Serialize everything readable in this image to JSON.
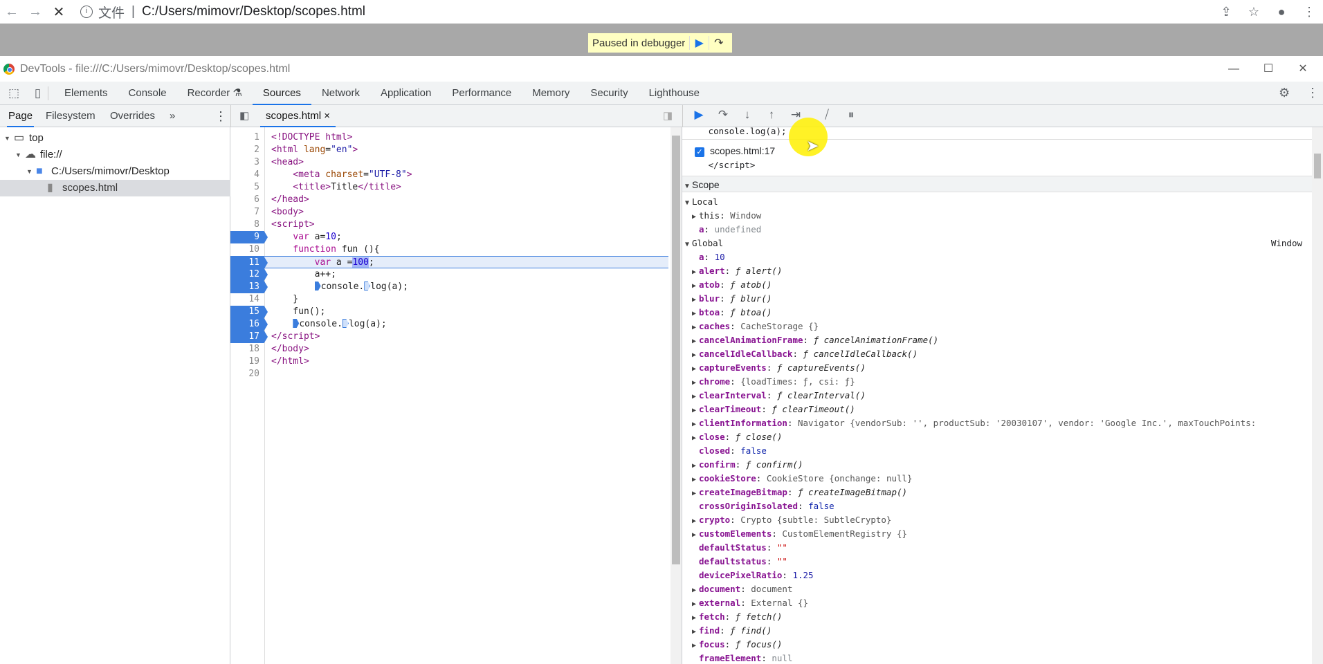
{
  "browser": {
    "back_icon": "arrow-left",
    "forward_icon": "arrow-right",
    "stop_icon": "close",
    "info_label": "文件",
    "url": "C:/Users/mimovr/Desktop/scopes.html"
  },
  "banner": {
    "text": "Paused in debugger"
  },
  "devtools": {
    "title": "DevTools - file:///C:/Users/mimovr/Desktop/scopes.html",
    "tabs": [
      "Elements",
      "Console",
      "Recorder",
      "Sources",
      "Network",
      "Application",
      "Performance",
      "Memory",
      "Security",
      "Lighthouse"
    ],
    "active_tab": "Sources"
  },
  "navigator": {
    "tabs": [
      "Page",
      "Filesystem",
      "Overrides"
    ],
    "more": "»",
    "tree": [
      {
        "label": "top",
        "depth": 0,
        "icon": "frame"
      },
      {
        "label": "file://",
        "depth": 1,
        "icon": "cloud"
      },
      {
        "label": "C:/Users/mimovr/Desktop",
        "depth": 2,
        "icon": "folder"
      },
      {
        "label": "scopes.html",
        "depth": 3,
        "icon": "file",
        "selected": true
      }
    ]
  },
  "editor": {
    "file_tab": "scopes.html",
    "close": "×",
    "current_line": 11,
    "breakpoints": [
      9,
      11,
      12,
      13,
      15,
      16,
      17
    ],
    "lines": [
      [
        [
          "<!DOCTYPE html>",
          "tag"
        ]
      ],
      [
        [
          "<html ",
          "tag"
        ],
        [
          "lang",
          "attr"
        ],
        [
          "=",
          "p"
        ],
        [
          "\"en\"",
          "str"
        ],
        [
          ">",
          "tag"
        ]
      ],
      [
        [
          "<head>",
          "tag"
        ]
      ],
      [
        [
          "    <meta ",
          "tag"
        ],
        [
          "charset",
          "attr"
        ],
        [
          "=",
          "p"
        ],
        [
          "\"UTF-8\"",
          "str"
        ],
        [
          ">",
          "tag"
        ]
      ],
      [
        [
          "    <title>",
          "tag"
        ],
        [
          "Title",
          "p"
        ],
        [
          "</title>",
          "tag"
        ]
      ],
      [
        [
          "</head>",
          "tag"
        ]
      ],
      [
        [
          "<body>",
          "tag"
        ]
      ],
      [
        [
          "<script>",
          "tag"
        ]
      ],
      [
        [
          "    ",
          "p"
        ],
        [
          "var",
          "kw"
        ],
        [
          " a=",
          "p"
        ],
        [
          "10",
          "num"
        ],
        [
          ";",
          "p"
        ]
      ],
      [
        [
          "    ",
          "p"
        ],
        [
          "function",
          "kw"
        ],
        [
          " fun (){",
          "p"
        ]
      ],
      [
        [
          "        ",
          "p"
        ],
        [
          "var",
          "kw"
        ],
        [
          " a =",
          "p"
        ],
        [
          "100",
          "sel"
        ],
        [
          ";",
          "p"
        ]
      ],
      [
        [
          "        a++;",
          "p"
        ]
      ],
      [
        [
          "        ",
          "p"
        ],
        [
          "",
          "bp"
        ],
        [
          "console.",
          "p"
        ],
        [
          "",
          "bpoff"
        ],
        [
          "log(a);",
          "p"
        ]
      ],
      [
        [
          "    }",
          "p"
        ]
      ],
      [
        [
          "    fun();",
          "p"
        ]
      ],
      [
        [
          "    ",
          "p"
        ],
        [
          "",
          "bp"
        ],
        [
          "console.",
          "p"
        ],
        [
          "",
          "bpoff"
        ],
        [
          "log(a);",
          "p"
        ]
      ],
      [
        [
          "</script>",
          "tag"
        ]
      ],
      [
        [
          "</body>",
          "tag"
        ]
      ],
      [
        [
          "</html>",
          "tag"
        ]
      ],
      []
    ]
  },
  "debugger": {
    "toolbar": [
      "resume",
      "step-over",
      "step-into",
      "step-out",
      "step",
      "deactivate-breakpoints",
      "pause-on-exceptions"
    ],
    "breakpoint_prev_code": "console.log(a);",
    "breakpoint": {
      "label": "scopes.html:17",
      "code": "</script>",
      "checked": true
    },
    "scope_title": "Scope",
    "local": {
      "title": "Local",
      "items": [
        {
          "k": "this",
          "v": "Window",
          "t": "obj",
          "exp": true,
          "kc": "plain"
        },
        {
          "k": "a",
          "v": "undefined",
          "t": "undef"
        }
      ]
    },
    "global": {
      "title": "Global",
      "value": "Window",
      "items": [
        {
          "k": "a",
          "v": "10",
          "t": "num"
        },
        {
          "k": "alert",
          "v": "ƒ alert()",
          "t": "fn",
          "exp": true
        },
        {
          "k": "atob",
          "v": "ƒ atob()",
          "t": "fn",
          "exp": true
        },
        {
          "k": "blur",
          "v": "ƒ blur()",
          "t": "fn",
          "exp": true
        },
        {
          "k": "btoa",
          "v": "ƒ btoa()",
          "t": "fn",
          "exp": true
        },
        {
          "k": "caches",
          "v": "CacheStorage {}",
          "t": "obj",
          "exp": true
        },
        {
          "k": "cancelAnimationFrame",
          "v": "ƒ cancelAnimationFrame()",
          "t": "fn",
          "exp": true
        },
        {
          "k": "cancelIdleCallback",
          "v": "ƒ cancelIdleCallback()",
          "t": "fn",
          "exp": true
        },
        {
          "k": "captureEvents",
          "v": "ƒ captureEvents()",
          "t": "fn",
          "exp": true
        },
        {
          "k": "chrome",
          "v": "{loadTimes: ƒ, csi: ƒ}",
          "t": "obj",
          "exp": true
        },
        {
          "k": "clearInterval",
          "v": "ƒ clearInterval()",
          "t": "fn",
          "exp": true
        },
        {
          "k": "clearTimeout",
          "v": "ƒ clearTimeout()",
          "t": "fn",
          "exp": true
        },
        {
          "k": "clientInformation",
          "v": "Navigator {vendorSub: '', productSub: '20030107', vendor: 'Google Inc.', maxTouchPoints:",
          "t": "obj",
          "exp": true
        },
        {
          "k": "close",
          "v": "ƒ close()",
          "t": "fn",
          "exp": true
        },
        {
          "k": "closed",
          "v": "false",
          "t": "kw"
        },
        {
          "k": "confirm",
          "v": "ƒ confirm()",
          "t": "fn",
          "exp": true
        },
        {
          "k": "cookieStore",
          "v": "CookieStore {onchange: null}",
          "t": "obj",
          "exp": true
        },
        {
          "k": "createImageBitmap",
          "v": "ƒ createImageBitmap()",
          "t": "fn",
          "exp": true
        },
        {
          "k": "crossOriginIsolated",
          "v": "false",
          "t": "kw"
        },
        {
          "k": "crypto",
          "v": "Crypto {subtle: SubtleCrypto}",
          "t": "obj",
          "exp": true
        },
        {
          "k": "customElements",
          "v": "CustomElementRegistry {}",
          "t": "obj",
          "exp": true
        },
        {
          "k": "defaultStatus",
          "v": "\"\"",
          "t": "str"
        },
        {
          "k": "defaultstatus",
          "v": "\"\"",
          "t": "str"
        },
        {
          "k": "devicePixelRatio",
          "v": "1.25",
          "t": "num"
        },
        {
          "k": "document",
          "v": "document",
          "t": "obj",
          "exp": true
        },
        {
          "k": "external",
          "v": "External {}",
          "t": "obj",
          "exp": true
        },
        {
          "k": "fetch",
          "v": "ƒ fetch()",
          "t": "fn",
          "exp": true
        },
        {
          "k": "find",
          "v": "ƒ find()",
          "t": "fn",
          "exp": true
        },
        {
          "k": "focus",
          "v": "ƒ focus()",
          "t": "fn",
          "exp": true
        },
        {
          "k": "frameElement",
          "v": "null",
          "t": "undef"
        }
      ]
    }
  },
  "colors": {
    "accent": "#1a73e8",
    "breakpoint": "#3b7ddd",
    "banner": "#ffffc2"
  }
}
